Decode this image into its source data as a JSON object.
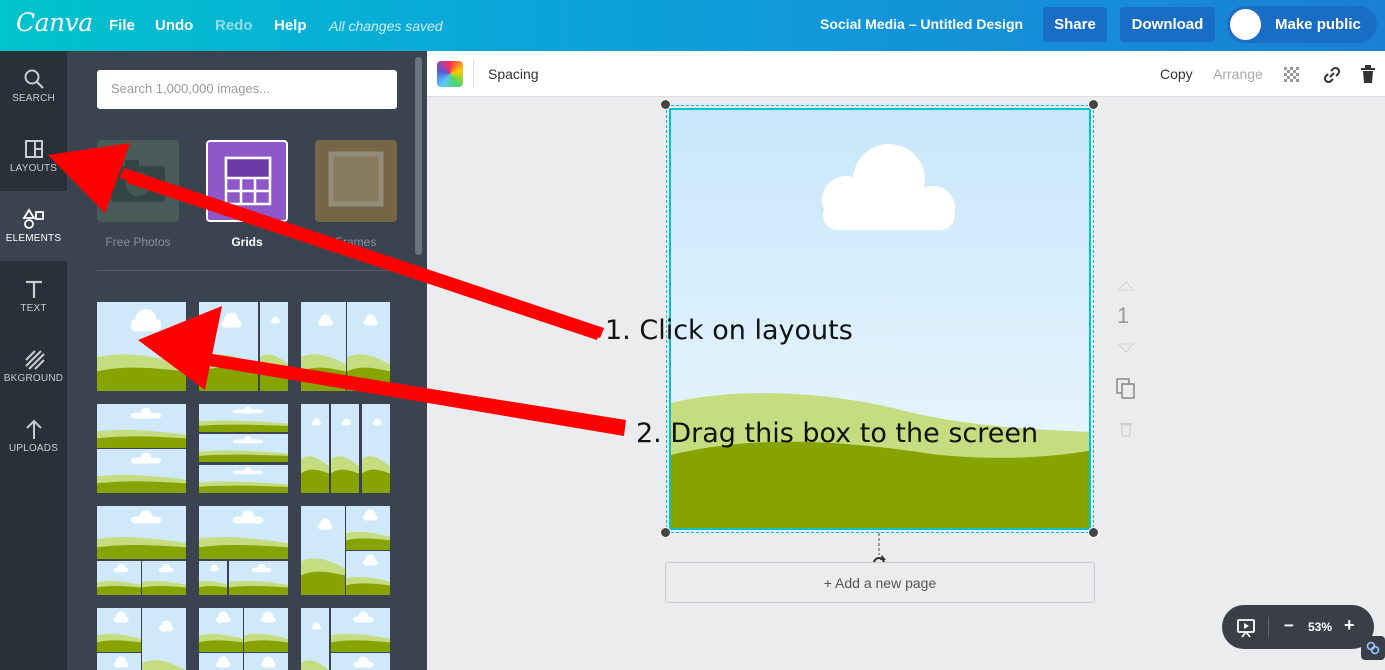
{
  "topbar": {
    "logo": "Canva",
    "menu": [
      {
        "label": "File",
        "enabled": true
      },
      {
        "label": "Undo",
        "enabled": true
      },
      {
        "label": "Redo",
        "enabled": false
      },
      {
        "label": "Help",
        "enabled": true
      }
    ],
    "save_status": "All changes saved",
    "design_title": "Social Media – Untitled Design",
    "share_label": "Share",
    "download_label": "Download",
    "make_public_label": "Make public"
  },
  "leftnav": {
    "items": [
      {
        "label": "SEARCH",
        "icon": "search-icon"
      },
      {
        "label": "LAYOUTS",
        "icon": "layouts-icon"
      },
      {
        "label": "ELEMENTS",
        "icon": "elements-icon",
        "active": true
      },
      {
        "label": "TEXT",
        "icon": "text-icon"
      },
      {
        "label": "BKGROUND",
        "icon": "background-icon"
      },
      {
        "label": "UPLOADS",
        "icon": "uploads-icon"
      }
    ]
  },
  "panel": {
    "search_placeholder": "Search 1,000,000 images...",
    "categories": [
      {
        "label": "Free Photos",
        "selected": false
      },
      {
        "label": "Grids",
        "selected": true
      },
      {
        "label": "Frames",
        "selected": false
      }
    ]
  },
  "toolbar": {
    "spacing_label": "Spacing",
    "copy_label": "Copy",
    "arrange_label": "Arrange"
  },
  "canvas": {
    "add_page_label": "+ Add a new page",
    "page_number": "1"
  },
  "zoom": {
    "level": "53%",
    "minus": "−",
    "plus": "+"
  },
  "annotations": {
    "step1": "1. Click on layouts",
    "step2": "2. Drag this box to the screen",
    "arrow_color": "#ff0000"
  },
  "colors": {
    "accent": "#00c4cc",
    "sky": "#cfe9fb",
    "grass": "#86a300",
    "hill": "#c5dc80"
  }
}
